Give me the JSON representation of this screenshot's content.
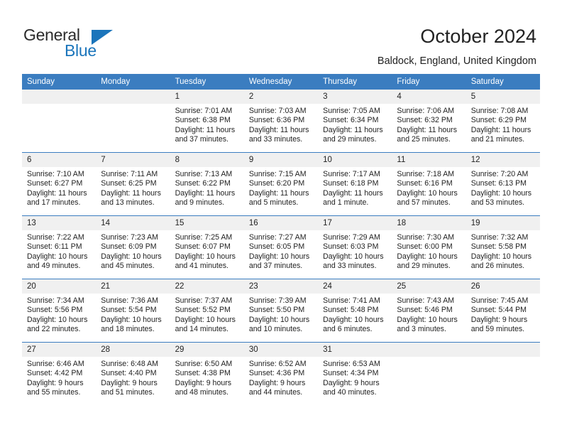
{
  "brand": {
    "name_part1": "General",
    "name_part2": "Blue",
    "accent_color": "#1b75bb"
  },
  "header": {
    "title": "October 2024",
    "subtitle": "Baldock, England, United Kingdom"
  },
  "theme": {
    "header_blue": "#3b7dc0",
    "daynum_band": "#f0f0f0",
    "text": "#222222"
  },
  "weekday_headers": [
    "Sunday",
    "Monday",
    "Tuesday",
    "Wednesday",
    "Thursday",
    "Friday",
    "Saturday"
  ],
  "labels": {
    "sunrise": "Sunrise:",
    "sunset": "Sunset:",
    "daylight": "Daylight:"
  },
  "weeks": [
    [
      {
        "day": "",
        "empty": true
      },
      {
        "day": "",
        "empty": true
      },
      {
        "day": "1",
        "sunrise": "Sunrise: 7:01 AM",
        "sunset": "Sunset: 6:38 PM",
        "daylight1": "Daylight: 11 hours",
        "daylight2": "and 37 minutes."
      },
      {
        "day": "2",
        "sunrise": "Sunrise: 7:03 AM",
        "sunset": "Sunset: 6:36 PM",
        "daylight1": "Daylight: 11 hours",
        "daylight2": "and 33 minutes."
      },
      {
        "day": "3",
        "sunrise": "Sunrise: 7:05 AM",
        "sunset": "Sunset: 6:34 PM",
        "daylight1": "Daylight: 11 hours",
        "daylight2": "and 29 minutes."
      },
      {
        "day": "4",
        "sunrise": "Sunrise: 7:06 AM",
        "sunset": "Sunset: 6:32 PM",
        "daylight1": "Daylight: 11 hours",
        "daylight2": "and 25 minutes."
      },
      {
        "day": "5",
        "sunrise": "Sunrise: 7:08 AM",
        "sunset": "Sunset: 6:29 PM",
        "daylight1": "Daylight: 11 hours",
        "daylight2": "and 21 minutes."
      }
    ],
    [
      {
        "day": "6",
        "sunrise": "Sunrise: 7:10 AM",
        "sunset": "Sunset: 6:27 PM",
        "daylight1": "Daylight: 11 hours",
        "daylight2": "and 17 minutes."
      },
      {
        "day": "7",
        "sunrise": "Sunrise: 7:11 AM",
        "sunset": "Sunset: 6:25 PM",
        "daylight1": "Daylight: 11 hours",
        "daylight2": "and 13 minutes."
      },
      {
        "day": "8",
        "sunrise": "Sunrise: 7:13 AM",
        "sunset": "Sunset: 6:22 PM",
        "daylight1": "Daylight: 11 hours",
        "daylight2": "and 9 minutes."
      },
      {
        "day": "9",
        "sunrise": "Sunrise: 7:15 AM",
        "sunset": "Sunset: 6:20 PM",
        "daylight1": "Daylight: 11 hours",
        "daylight2": "and 5 minutes."
      },
      {
        "day": "10",
        "sunrise": "Sunrise: 7:17 AM",
        "sunset": "Sunset: 6:18 PM",
        "daylight1": "Daylight: 11 hours",
        "daylight2": "and 1 minute."
      },
      {
        "day": "11",
        "sunrise": "Sunrise: 7:18 AM",
        "sunset": "Sunset: 6:16 PM",
        "daylight1": "Daylight: 10 hours",
        "daylight2": "and 57 minutes."
      },
      {
        "day": "12",
        "sunrise": "Sunrise: 7:20 AM",
        "sunset": "Sunset: 6:13 PM",
        "daylight1": "Daylight: 10 hours",
        "daylight2": "and 53 minutes."
      }
    ],
    [
      {
        "day": "13",
        "sunrise": "Sunrise: 7:22 AM",
        "sunset": "Sunset: 6:11 PM",
        "daylight1": "Daylight: 10 hours",
        "daylight2": "and 49 minutes."
      },
      {
        "day": "14",
        "sunrise": "Sunrise: 7:23 AM",
        "sunset": "Sunset: 6:09 PM",
        "daylight1": "Daylight: 10 hours",
        "daylight2": "and 45 minutes."
      },
      {
        "day": "15",
        "sunrise": "Sunrise: 7:25 AM",
        "sunset": "Sunset: 6:07 PM",
        "daylight1": "Daylight: 10 hours",
        "daylight2": "and 41 minutes."
      },
      {
        "day": "16",
        "sunrise": "Sunrise: 7:27 AM",
        "sunset": "Sunset: 6:05 PM",
        "daylight1": "Daylight: 10 hours",
        "daylight2": "and 37 minutes."
      },
      {
        "day": "17",
        "sunrise": "Sunrise: 7:29 AM",
        "sunset": "Sunset: 6:03 PM",
        "daylight1": "Daylight: 10 hours",
        "daylight2": "and 33 minutes."
      },
      {
        "day": "18",
        "sunrise": "Sunrise: 7:30 AM",
        "sunset": "Sunset: 6:00 PM",
        "daylight1": "Daylight: 10 hours",
        "daylight2": "and 29 minutes."
      },
      {
        "day": "19",
        "sunrise": "Sunrise: 7:32 AM",
        "sunset": "Sunset: 5:58 PM",
        "daylight1": "Daylight: 10 hours",
        "daylight2": "and 26 minutes."
      }
    ],
    [
      {
        "day": "20",
        "sunrise": "Sunrise: 7:34 AM",
        "sunset": "Sunset: 5:56 PM",
        "daylight1": "Daylight: 10 hours",
        "daylight2": "and 22 minutes."
      },
      {
        "day": "21",
        "sunrise": "Sunrise: 7:36 AM",
        "sunset": "Sunset: 5:54 PM",
        "daylight1": "Daylight: 10 hours",
        "daylight2": "and 18 minutes."
      },
      {
        "day": "22",
        "sunrise": "Sunrise: 7:37 AM",
        "sunset": "Sunset: 5:52 PM",
        "daylight1": "Daylight: 10 hours",
        "daylight2": "and 14 minutes."
      },
      {
        "day": "23",
        "sunrise": "Sunrise: 7:39 AM",
        "sunset": "Sunset: 5:50 PM",
        "daylight1": "Daylight: 10 hours",
        "daylight2": "and 10 minutes."
      },
      {
        "day": "24",
        "sunrise": "Sunrise: 7:41 AM",
        "sunset": "Sunset: 5:48 PM",
        "daylight1": "Daylight: 10 hours",
        "daylight2": "and 6 minutes."
      },
      {
        "day": "25",
        "sunrise": "Sunrise: 7:43 AM",
        "sunset": "Sunset: 5:46 PM",
        "daylight1": "Daylight: 10 hours",
        "daylight2": "and 3 minutes."
      },
      {
        "day": "26",
        "sunrise": "Sunrise: 7:45 AM",
        "sunset": "Sunset: 5:44 PM",
        "daylight1": "Daylight: 9 hours",
        "daylight2": "and 59 minutes."
      }
    ],
    [
      {
        "day": "27",
        "sunrise": "Sunrise: 6:46 AM",
        "sunset": "Sunset: 4:42 PM",
        "daylight1": "Daylight: 9 hours",
        "daylight2": "and 55 minutes."
      },
      {
        "day": "28",
        "sunrise": "Sunrise: 6:48 AM",
        "sunset": "Sunset: 4:40 PM",
        "daylight1": "Daylight: 9 hours",
        "daylight2": "and 51 minutes."
      },
      {
        "day": "29",
        "sunrise": "Sunrise: 6:50 AM",
        "sunset": "Sunset: 4:38 PM",
        "daylight1": "Daylight: 9 hours",
        "daylight2": "and 48 minutes."
      },
      {
        "day": "30",
        "sunrise": "Sunrise: 6:52 AM",
        "sunset": "Sunset: 4:36 PM",
        "daylight1": "Daylight: 9 hours",
        "daylight2": "and 44 minutes."
      },
      {
        "day": "31",
        "sunrise": "Sunrise: 6:53 AM",
        "sunset": "Sunset: 4:34 PM",
        "daylight1": "Daylight: 9 hours",
        "daylight2": "and 40 minutes."
      },
      {
        "day": "",
        "empty": true
      },
      {
        "day": "",
        "empty": true
      }
    ]
  ]
}
